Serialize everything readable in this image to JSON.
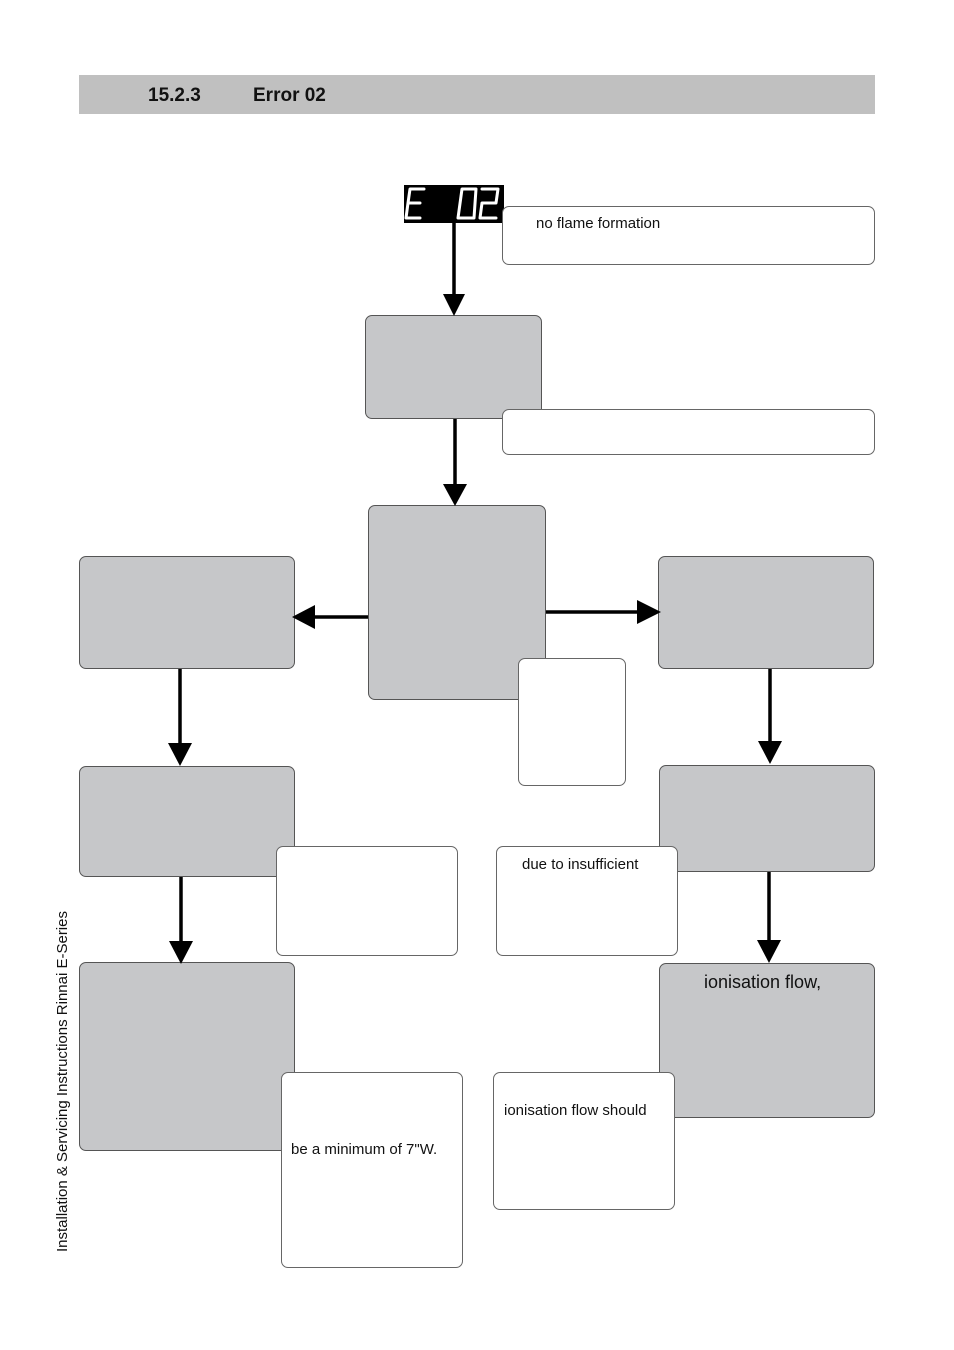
{
  "header": {
    "section_number": "15.2.3",
    "title": "Error 02"
  },
  "display": {
    "code": "E 02",
    "icon": "seven-segment-display"
  },
  "notes": {
    "error_note": "no flame formation",
    "note_after_step1": "",
    "note_center": "",
    "note_left_middle": "",
    "note_right_middle": "due to insufficient",
    "note_left_bottom": "be a minimum of 7\"W.",
    "note_right_bottom": "ionisation flow should"
  },
  "steps": {
    "step1": "",
    "decision": "",
    "left_1": "",
    "left_2": "",
    "left_3": "",
    "right_1": "",
    "right_2": "",
    "right_3": "ionisation flow,"
  },
  "footer": {
    "side_text": "Installation & Servicing Instructions Rinnai E-Series"
  },
  "colors": {
    "header_bar": "#c0c0c0",
    "step_fill": "#c6c7c9",
    "display_bg": "#000000",
    "display_fg": "#ffffff"
  }
}
